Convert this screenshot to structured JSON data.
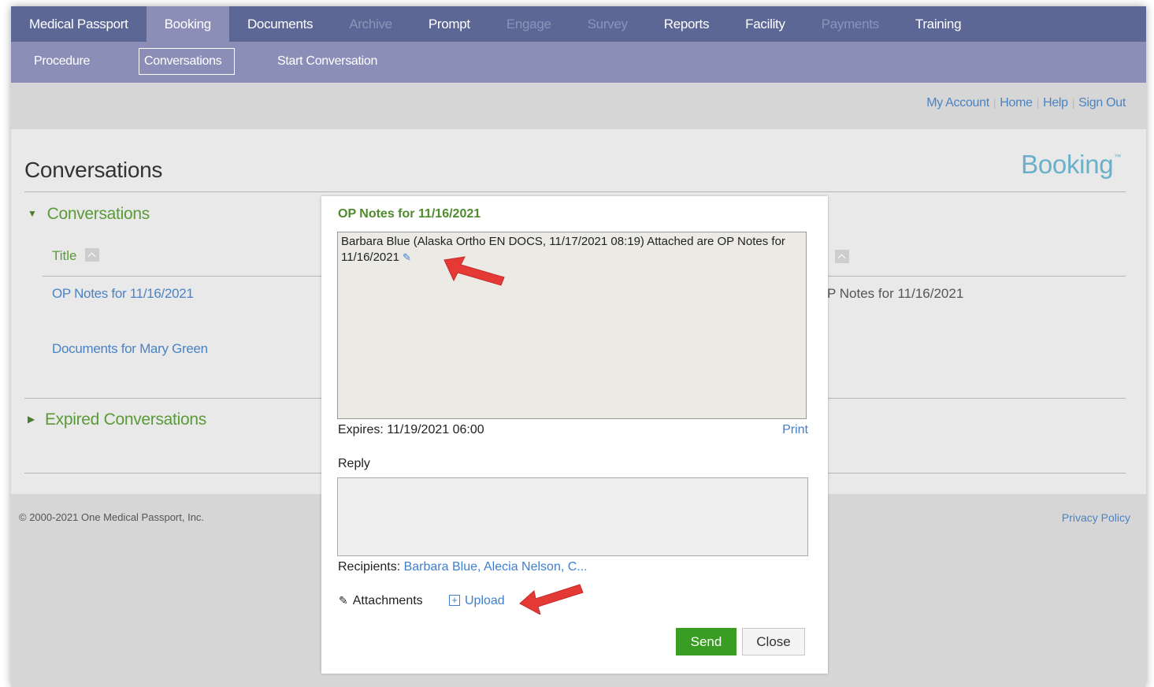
{
  "top_nav": {
    "tabs": [
      {
        "label": "Medical Passport",
        "state": "normal"
      },
      {
        "label": "Booking",
        "state": "active"
      },
      {
        "label": "Documents",
        "state": "normal"
      },
      {
        "label": "Archive",
        "state": "disabled"
      },
      {
        "label": "Prompt",
        "state": "normal"
      },
      {
        "label": "Engage",
        "state": "disabled"
      },
      {
        "label": "Survey",
        "state": "disabled"
      },
      {
        "label": "Reports",
        "state": "normal"
      },
      {
        "label": "Facility",
        "state": "normal"
      },
      {
        "label": "Payments",
        "state": "disabled"
      },
      {
        "label": "Training",
        "state": "normal"
      }
    ]
  },
  "sub_nav": {
    "procedure": "Procedure",
    "conversations": "Conversations",
    "start_conversation": "Start Conversation"
  },
  "account_links": {
    "my_account": "My Account",
    "home": "Home",
    "help": "Help",
    "sign_out": "Sign Out"
  },
  "page": {
    "title": "Conversations",
    "brand": "Booking",
    "brand_mark": "™"
  },
  "conversations_section": {
    "heading": "Conversations",
    "column_title": "Title",
    "rows": [
      {
        "title": "OP Notes for 11/16/2021",
        "trailing_text": "P Notes for 11/16/2021"
      },
      {
        "title": "Documents for Mary Green"
      }
    ]
  },
  "expired_section": {
    "heading": "Expired Conversations"
  },
  "footer": {
    "copyright": "© 2000-2021 One Medical Passport, Inc.",
    "privacy": "Privacy Policy"
  },
  "modal": {
    "title": "OP Notes for 11/16/2021",
    "message": "Barbara Blue (Alaska Ortho EN DOCS, 11/17/2021 08:19) Attached are OP Notes for 11/16/2021",
    "expires": "Expires: 11/19/2021 06:00",
    "print": "Print",
    "reply_label": "Reply",
    "reply_value": "",
    "recipients_label": "Recipients:",
    "recipients_names": "Barbara Blue, Alecia Nelson, C...",
    "attachments_label": "Attachments",
    "upload_label": "Upload",
    "send_label": "Send",
    "close_label": "Close"
  },
  "colors": {
    "top_nav_bg": "#5d6796",
    "sub_nav_bg": "#8b8fb8",
    "section_green": "#5a9a38",
    "link_blue": "#4a83c4",
    "send_green": "#3a9d23",
    "annotation_arrow": "#e53935"
  },
  "icons": {
    "expand_collapse": "triangle-icon",
    "sort": "sort-ascending-icon",
    "attachment": "paperclip-icon",
    "upload": "plus-box-icon",
    "annotation": "red-arrow-icon"
  }
}
